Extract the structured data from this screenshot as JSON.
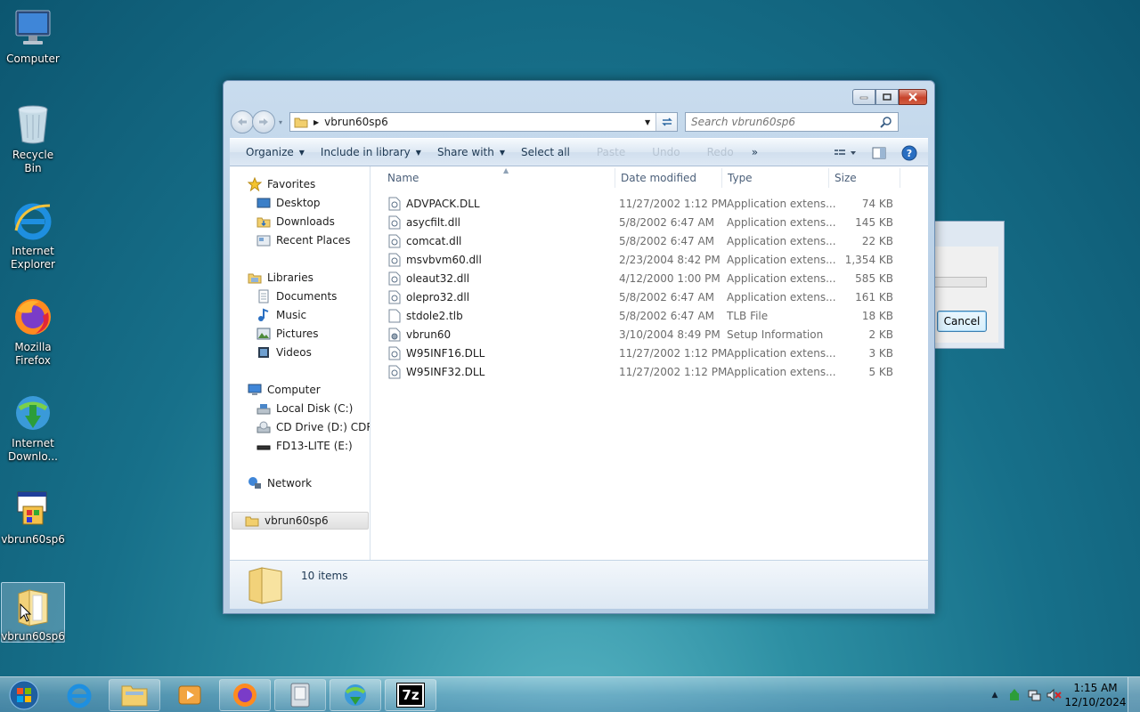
{
  "desktop": {
    "icons": [
      {
        "label": "Computer",
        "icon": "computer-icon"
      },
      {
        "label": "Recycle Bin",
        "icon": "recycle-bin-icon"
      },
      {
        "label": "Internet Explorer",
        "icon": "internet-explorer-icon"
      },
      {
        "label": "Mozilla Firefox",
        "icon": "firefox-icon"
      },
      {
        "label": "Internet Downlo...",
        "icon": "internet-download-manager-icon"
      },
      {
        "label": "vbrun60sp6",
        "icon": "installer-icon"
      },
      {
        "label": "vbrun60sp6",
        "icon": "folder-icon"
      }
    ]
  },
  "bg_dialog": {
    "cancel_label": "Cancel"
  },
  "explorer": {
    "address": {
      "crumb": "vbrun60sp6"
    },
    "search": {
      "placeholder": "Search vbrun60sp6"
    },
    "toolbar": {
      "organize": "Organize",
      "include_in_library": "Include in library",
      "share_with": "Share with",
      "select_all": "Select all",
      "paste": "Paste",
      "undo": "Undo",
      "redo": "Redo",
      "more": "»"
    },
    "nav": {
      "favorites": "Favorites",
      "desktop": "Desktop",
      "downloads": "Downloads",
      "recent_places": "Recent Places",
      "libraries": "Libraries",
      "documents": "Documents",
      "music": "Music",
      "pictures": "Pictures",
      "videos": "Videos",
      "computer": "Computer",
      "local_disk": "Local Disk (C:)",
      "cd_drive": "CD Drive (D:) CDROM",
      "fd13": "FD13-LITE (E:)",
      "network": "Network",
      "current_folder": "vbrun60sp6"
    },
    "columns": {
      "name": "Name",
      "date": "Date modified",
      "type": "Type",
      "size": "Size"
    },
    "files": [
      {
        "name": "ADVPACK.DLL",
        "date": "11/27/2002 1:12 PM",
        "type": "Application extens...",
        "size": "74 KB"
      },
      {
        "name": "asycfilt.dll",
        "date": "5/8/2002 6:47 AM",
        "type": "Application extens...",
        "size": "145 KB"
      },
      {
        "name": "comcat.dll",
        "date": "5/8/2002 6:47 AM",
        "type": "Application extens...",
        "size": "22 KB"
      },
      {
        "name": "msvbvm60.dll",
        "date": "2/23/2004 8:42 PM",
        "type": "Application extens...",
        "size": "1,354 KB"
      },
      {
        "name": "oleaut32.dll",
        "date": "4/12/2000 1:00 PM",
        "type": "Application extens...",
        "size": "585 KB"
      },
      {
        "name": "olepro32.dll",
        "date": "5/8/2002 6:47 AM",
        "type": "Application extens...",
        "size": "161 KB"
      },
      {
        "name": "stdole2.tlb",
        "date": "5/8/2002 6:47 AM",
        "type": "TLB File",
        "size": "18 KB"
      },
      {
        "name": "vbrun60",
        "date": "3/10/2004 8:49 PM",
        "type": "Setup Information",
        "size": "2 KB"
      },
      {
        "name": "W95INF16.DLL",
        "date": "11/27/2002 1:12 PM",
        "type": "Application extens...",
        "size": "3 KB"
      },
      {
        "name": "W95INF32.DLL",
        "date": "11/27/2002 1:12 PM",
        "type": "Application extens...",
        "size": "5 KB"
      }
    ],
    "details": {
      "count": "10 items"
    }
  },
  "taskbar": {
    "clock_time": "1:15 AM",
    "clock_date": "12/10/2024",
    "seven_zip_label": "7z"
  }
}
